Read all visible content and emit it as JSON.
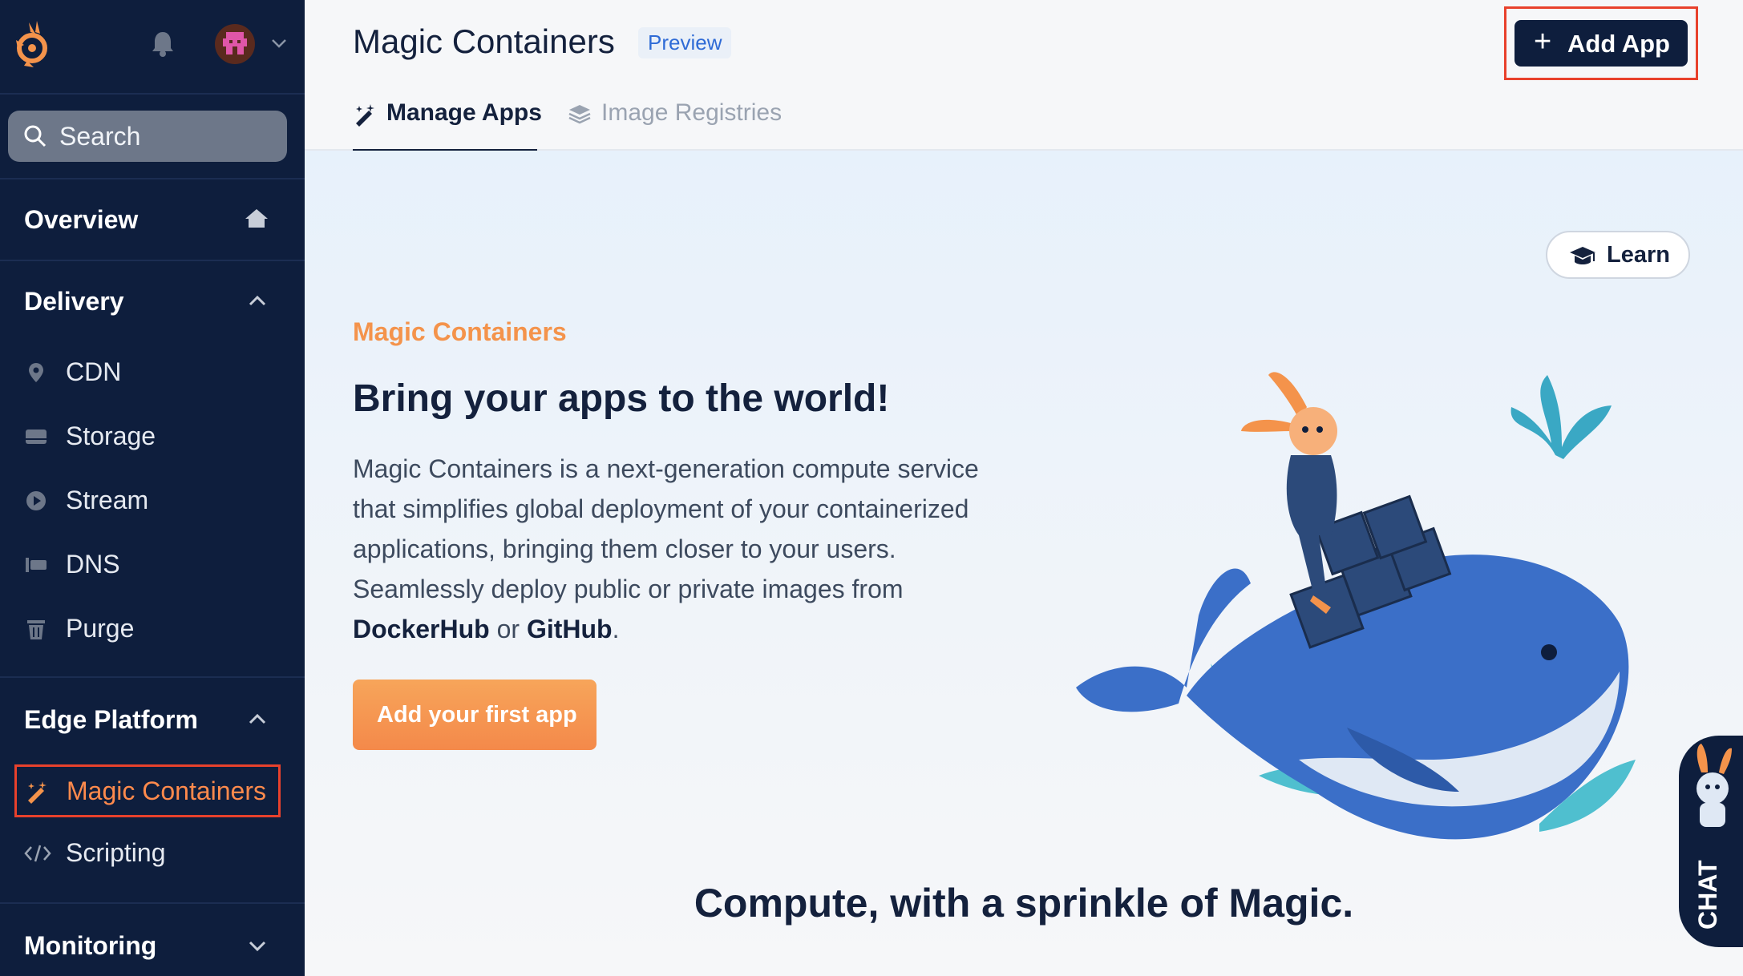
{
  "sidebar": {
    "search_placeholder": "Search",
    "overview_label": "Overview",
    "sections": {
      "delivery": {
        "label": "Delivery"
      },
      "edge": {
        "label": "Edge Platform"
      },
      "monitoring": {
        "label": "Monitoring"
      }
    },
    "delivery_items": [
      {
        "label": "CDN",
        "icon": "map-pin-icon"
      },
      {
        "label": "Storage",
        "icon": "storage-icon"
      },
      {
        "label": "Stream",
        "icon": "play-icon"
      },
      {
        "label": "DNS",
        "icon": "dns-icon"
      },
      {
        "label": "Purge",
        "icon": "trash-icon"
      }
    ],
    "edge_items": [
      {
        "label": "Magic Containers",
        "icon": "magic-wand-icon",
        "active": true
      },
      {
        "label": "Scripting",
        "icon": "code-icon"
      }
    ]
  },
  "header": {
    "title": "Magic Containers",
    "badge": "Preview",
    "add_app_label": "Add App",
    "tabs": [
      {
        "label": "Manage Apps",
        "active": true
      },
      {
        "label": "Image Registries",
        "active": false
      }
    ]
  },
  "hero": {
    "learn_label": "Learn",
    "eyebrow": "Magic Containers",
    "headline": "Bring your apps to the world!",
    "desc_part1": "Magic Containers is a next-generation compute service that simplifies global deployment of your containerized applications, bringing them closer to your users. Seamlessly deploy public or private images from ",
    "desc_bold1": "DockerHub",
    "desc_part2": " or ",
    "desc_bold2": "GitHub",
    "desc_part3": ".",
    "cta_label": "Add your first app",
    "bottom_heading": "Compute, with a sprinkle of Magic."
  },
  "chat_label": "CHAT",
  "colors": {
    "sidebar_bg": "#0e1e3d",
    "accent_orange": "#f4934b",
    "highlight_red": "#e8412c",
    "whale_blue": "#3b6fc8"
  }
}
